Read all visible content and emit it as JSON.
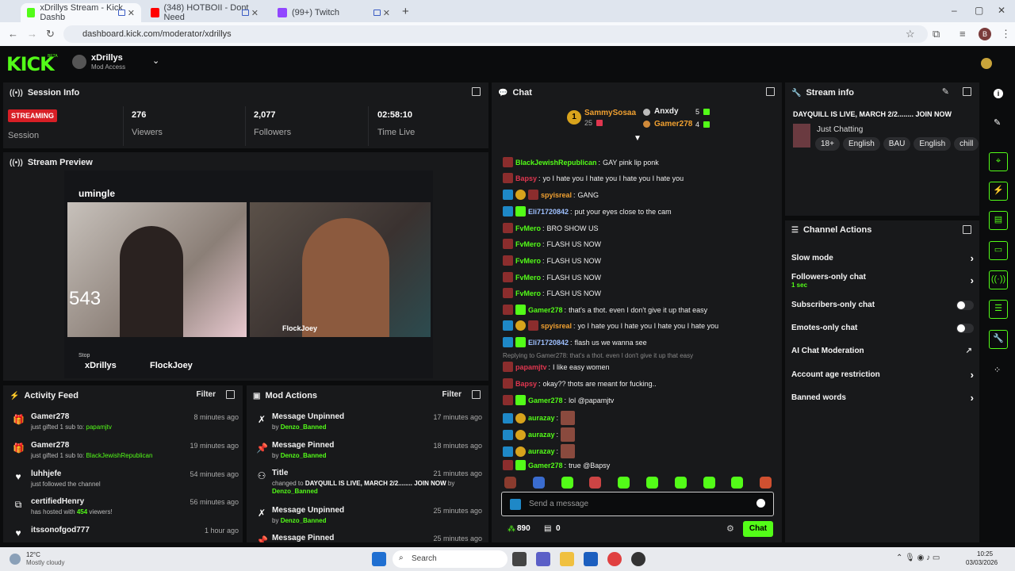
{
  "browser": {
    "tabs": [
      {
        "title": "xDrillys Stream - Kick Dashb",
        "active": true,
        "color": "#53fc18"
      },
      {
        "title": "(348) HOTBOII - Dont Need",
        "active": false,
        "color": "#ff0000"
      },
      {
        "title": "(99+) Twitch",
        "active": false,
        "color": "#9146ff"
      }
    ],
    "new_tab": "+",
    "url": "dashboard.kick.com/moderator/xdrillys",
    "profile_initial": "B"
  },
  "header": {
    "logo": "KICK",
    "logo_tag": "BETA",
    "channel": "xDrillys",
    "access": "Mod Access"
  },
  "session": {
    "title": "Session Info",
    "status": "STREAMING",
    "status_label": "Session",
    "viewers": "276",
    "viewers_label": "Viewers",
    "followers": "2,077",
    "followers_label": "Followers",
    "time_live": "02:58:10",
    "time_label": "Time Live"
  },
  "preview": {
    "title": "Stream Preview",
    "overlay_brand": "umingle",
    "overlay_count": "543",
    "overlay_name1": "xDrillys",
    "overlay_name2": "FlockJoey",
    "overlay_name3": "FlockJoey",
    "overlay_stop": "Stop"
  },
  "activity": {
    "title": "Activity Feed",
    "filter": "Filter",
    "items": [
      {
        "icon": "gift-icon",
        "name": "Gamer278",
        "text": "just gifted 1 sub to:",
        "target": "papamjtv",
        "time": "8 minutes ago"
      },
      {
        "icon": "gift-icon",
        "name": "Gamer278",
        "text": "just gifted 1 sub to:",
        "target": "BlackJewishRepublican",
        "time": "19 minutes ago"
      },
      {
        "icon": "heart-icon",
        "name": "luhhjefe",
        "text": "just followed the channel",
        "target": "",
        "time": "54 minutes ago"
      },
      {
        "icon": "host-icon",
        "name": "certifiedHenry",
        "text": "has hosted with",
        "target": "454",
        "suffix": "viewers!",
        "time": "56 minutes ago"
      },
      {
        "icon": "heart-icon",
        "name": "itssonofgod777",
        "text": "",
        "target": "",
        "time": "1 hour ago"
      }
    ]
  },
  "mod_actions": {
    "title": "Mod Actions",
    "filter": "Filter",
    "items": [
      {
        "icon": "unpin-icon",
        "title": "Message Unpinned",
        "by": "by",
        "user": "Denzo_Banned",
        "time": "17 minutes ago"
      },
      {
        "icon": "pin-icon",
        "title": "Message Pinned",
        "by": "by",
        "user": "Denzo_Banned",
        "time": "18 minutes ago"
      },
      {
        "icon": "title-icon",
        "title": "Title",
        "detail": "changed to",
        "value": "DAYQUILL IS LIVE, MARCH 2/2........ JOIN NOW",
        "by": "by",
        "user": "Denzo_Banned",
        "time": "21 minutes ago"
      },
      {
        "icon": "unpin-icon",
        "title": "Message Unpinned",
        "by": "by",
        "user": "Denzo_Banned",
        "time": "25 minutes ago"
      },
      {
        "icon": "pin-icon",
        "title": "Message Pinned",
        "time": "25 minutes ago"
      }
    ]
  },
  "chat": {
    "title": "Chat",
    "leaderboard": [
      {
        "rank": "1",
        "name": "SammySosaa",
        "score": "25"
      },
      {
        "name": "Anxdy",
        "score": "5"
      },
      {
        "name": "Gamer278",
        "score": "4"
      }
    ],
    "messages": [
      {
        "user": "BlackJewishRepublican",
        "color": "#53fc18",
        "text": "GAY pink lip ponk",
        "badges": [
          "og"
        ]
      },
      {
        "user": "Bapsy",
        "color": "#e0364f",
        "text": "yo I hate you I hate you I hate you I hate you",
        "badges": [
          "og"
        ]
      },
      {
        "user": "spyisreal",
        "color": "#f0a030",
        "text": "GANG",
        "badges": [
          "mod",
          "vip",
          "og"
        ]
      },
      {
        "user": "Eli71720842",
        "color": "#9ec0ff",
        "text": "put your eyes close to the cam",
        "badges": [
          "mod",
          "gift"
        ]
      },
      {
        "user": "FvMero",
        "color": "#53fc18",
        "text": "BRO SHOW US",
        "badges": [
          "og"
        ]
      },
      {
        "user": "FvMero",
        "color": "#53fc18",
        "text": "FLASH US NOW",
        "badges": [
          "og"
        ]
      },
      {
        "user": "FvMero",
        "color": "#53fc18",
        "text": "FLASH US NOW",
        "badges": [
          "og"
        ]
      },
      {
        "user": "FvMero",
        "color": "#53fc18",
        "text": "FLASH US NOW",
        "badges": [
          "og"
        ]
      },
      {
        "user": "FvMero",
        "color": "#53fc18",
        "text": "FLASH US NOW",
        "badges": [
          "og"
        ]
      },
      {
        "user": "Gamer278",
        "color": "#53fc18",
        "text": "that's a thot. even I don't give it up that easy",
        "badges": [
          "og",
          "gift"
        ]
      },
      {
        "user": "spyisreal",
        "color": "#f0a030",
        "text": "yo I hate you I hate you I hate you I hate you",
        "badges": [
          "mod",
          "vip",
          "og"
        ]
      },
      {
        "user": "Eli71720842",
        "color": "#9ec0ff",
        "text": "flash us we wanna see",
        "badges": [
          "mod",
          "gift"
        ]
      },
      {
        "reply": "Replying to Gamer278: that's a thot. even I don't give it up that easy"
      },
      {
        "user": "papamjtv",
        "color": "#e0364f",
        "text": "I like easy women",
        "badges": [
          "og"
        ]
      },
      {
        "user": "Bapsy",
        "color": "#e0364f",
        "text": "okay?? thots are meant for fucking..",
        "badges": [
          "og"
        ]
      },
      {
        "user": "Gamer278",
        "color": "#53fc18",
        "text": "lol @papamjtv",
        "badges": [
          "og",
          "gift"
        ]
      },
      {
        "user": "aurazay",
        "color": "#53fc18",
        "text": "",
        "badges": [
          "mod",
          "sub"
        ],
        "emote": true
      },
      {
        "user": "aurazay",
        "color": "#53fc18",
        "text": "",
        "badges": [
          "mod",
          "sub"
        ],
        "emote": true
      },
      {
        "user": "aurazay",
        "color": "#53fc18",
        "text": "",
        "badges": [
          "mod",
          "sub"
        ],
        "emote": true
      },
      {
        "user": "Gamer278",
        "color": "#53fc18",
        "text": "true @Bapsy",
        "badges": [
          "og",
          "gift"
        ]
      }
    ],
    "input_placeholder": "Send a message",
    "kicks": "890",
    "gifts": "0",
    "send": "Chat"
  },
  "stream_info": {
    "title": "Stream info",
    "stream_title": "DAYQUILL IS LIVE, MARCH 2/2........ JOIN NOW",
    "category": "Just Chatting",
    "tags": [
      "18+",
      "English",
      "BAU",
      "English",
      "chill"
    ]
  },
  "channel_actions": {
    "title": "Channel Actions",
    "items": [
      {
        "label": "Slow mode",
        "control": "chevron"
      },
      {
        "label": "Followers-only chat",
        "sub": "1 sec",
        "control": "chevron"
      },
      {
        "label": "Subscribers-only chat",
        "control": "toggle"
      },
      {
        "label": "Emotes-only chat",
        "control": "toggle"
      },
      {
        "label": "AI Chat Moderation",
        "control": "external"
      },
      {
        "label": "Account age restriction",
        "control": "chevron"
      },
      {
        "label": "Banned words",
        "control": "chevron"
      }
    ]
  },
  "taskbar": {
    "weather_temp": "12°C",
    "weather_desc": "Mostly cloudy",
    "search": "Search",
    "time": "10:25",
    "date": "03/03/2026"
  }
}
